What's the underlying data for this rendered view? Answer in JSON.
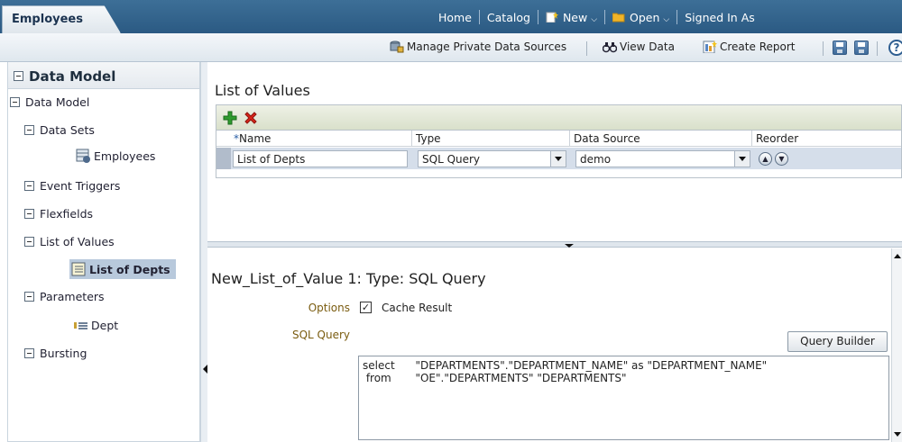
{
  "header": {
    "tab_label": "Employees",
    "links": {
      "home": "Home",
      "catalog": "Catalog",
      "new": "New",
      "open": "Open",
      "signed_in": "Signed In As"
    }
  },
  "toolbar": {
    "manage_private": "Manage Private Data Sources",
    "view_data": "View Data",
    "create_report": "Create Report",
    "help": "?"
  },
  "sidebar": {
    "title": "Data Model",
    "items": [
      {
        "label": "Data Model"
      },
      {
        "label": "Data Sets"
      },
      {
        "label": "Employees"
      },
      {
        "label": "Event Triggers"
      },
      {
        "label": "Flexfields"
      },
      {
        "label": "List of Values"
      },
      {
        "label": "List of Depts"
      },
      {
        "label": "Parameters"
      },
      {
        "label": "Dept"
      },
      {
        "label": "Bursting"
      }
    ]
  },
  "main": {
    "title": "List of Values",
    "grid": {
      "columns": {
        "required_mark": "*",
        "name": "Name",
        "type": "Type",
        "data_source": "Data Source",
        "reorder": "Reorder"
      },
      "rows": [
        {
          "name": "List of Depts",
          "type": "SQL Query",
          "data_source": "demo"
        }
      ]
    },
    "detail": {
      "title": "New_List_of_Value 1: Type: SQL Query",
      "options_label": "Options",
      "cache_result_label": "Cache Result",
      "cache_result_checked": true,
      "sql_query_label": "SQL Query",
      "query_builder_label": "Query Builder",
      "sql_text": "select      \"DEPARTMENTS\".\"DEPARTMENT_NAME\" as \"DEPARTMENT_NAME\"\n from       \"OE\".\"DEPARTMENTS\" \"DEPARTMENTS\""
    }
  },
  "colors": {
    "topbar": "#2b5a83",
    "selected": "#b8c9dc",
    "label_gold": "#7a5c10",
    "add_green": "#2e9b2e",
    "delete_red": "#d8261a"
  }
}
